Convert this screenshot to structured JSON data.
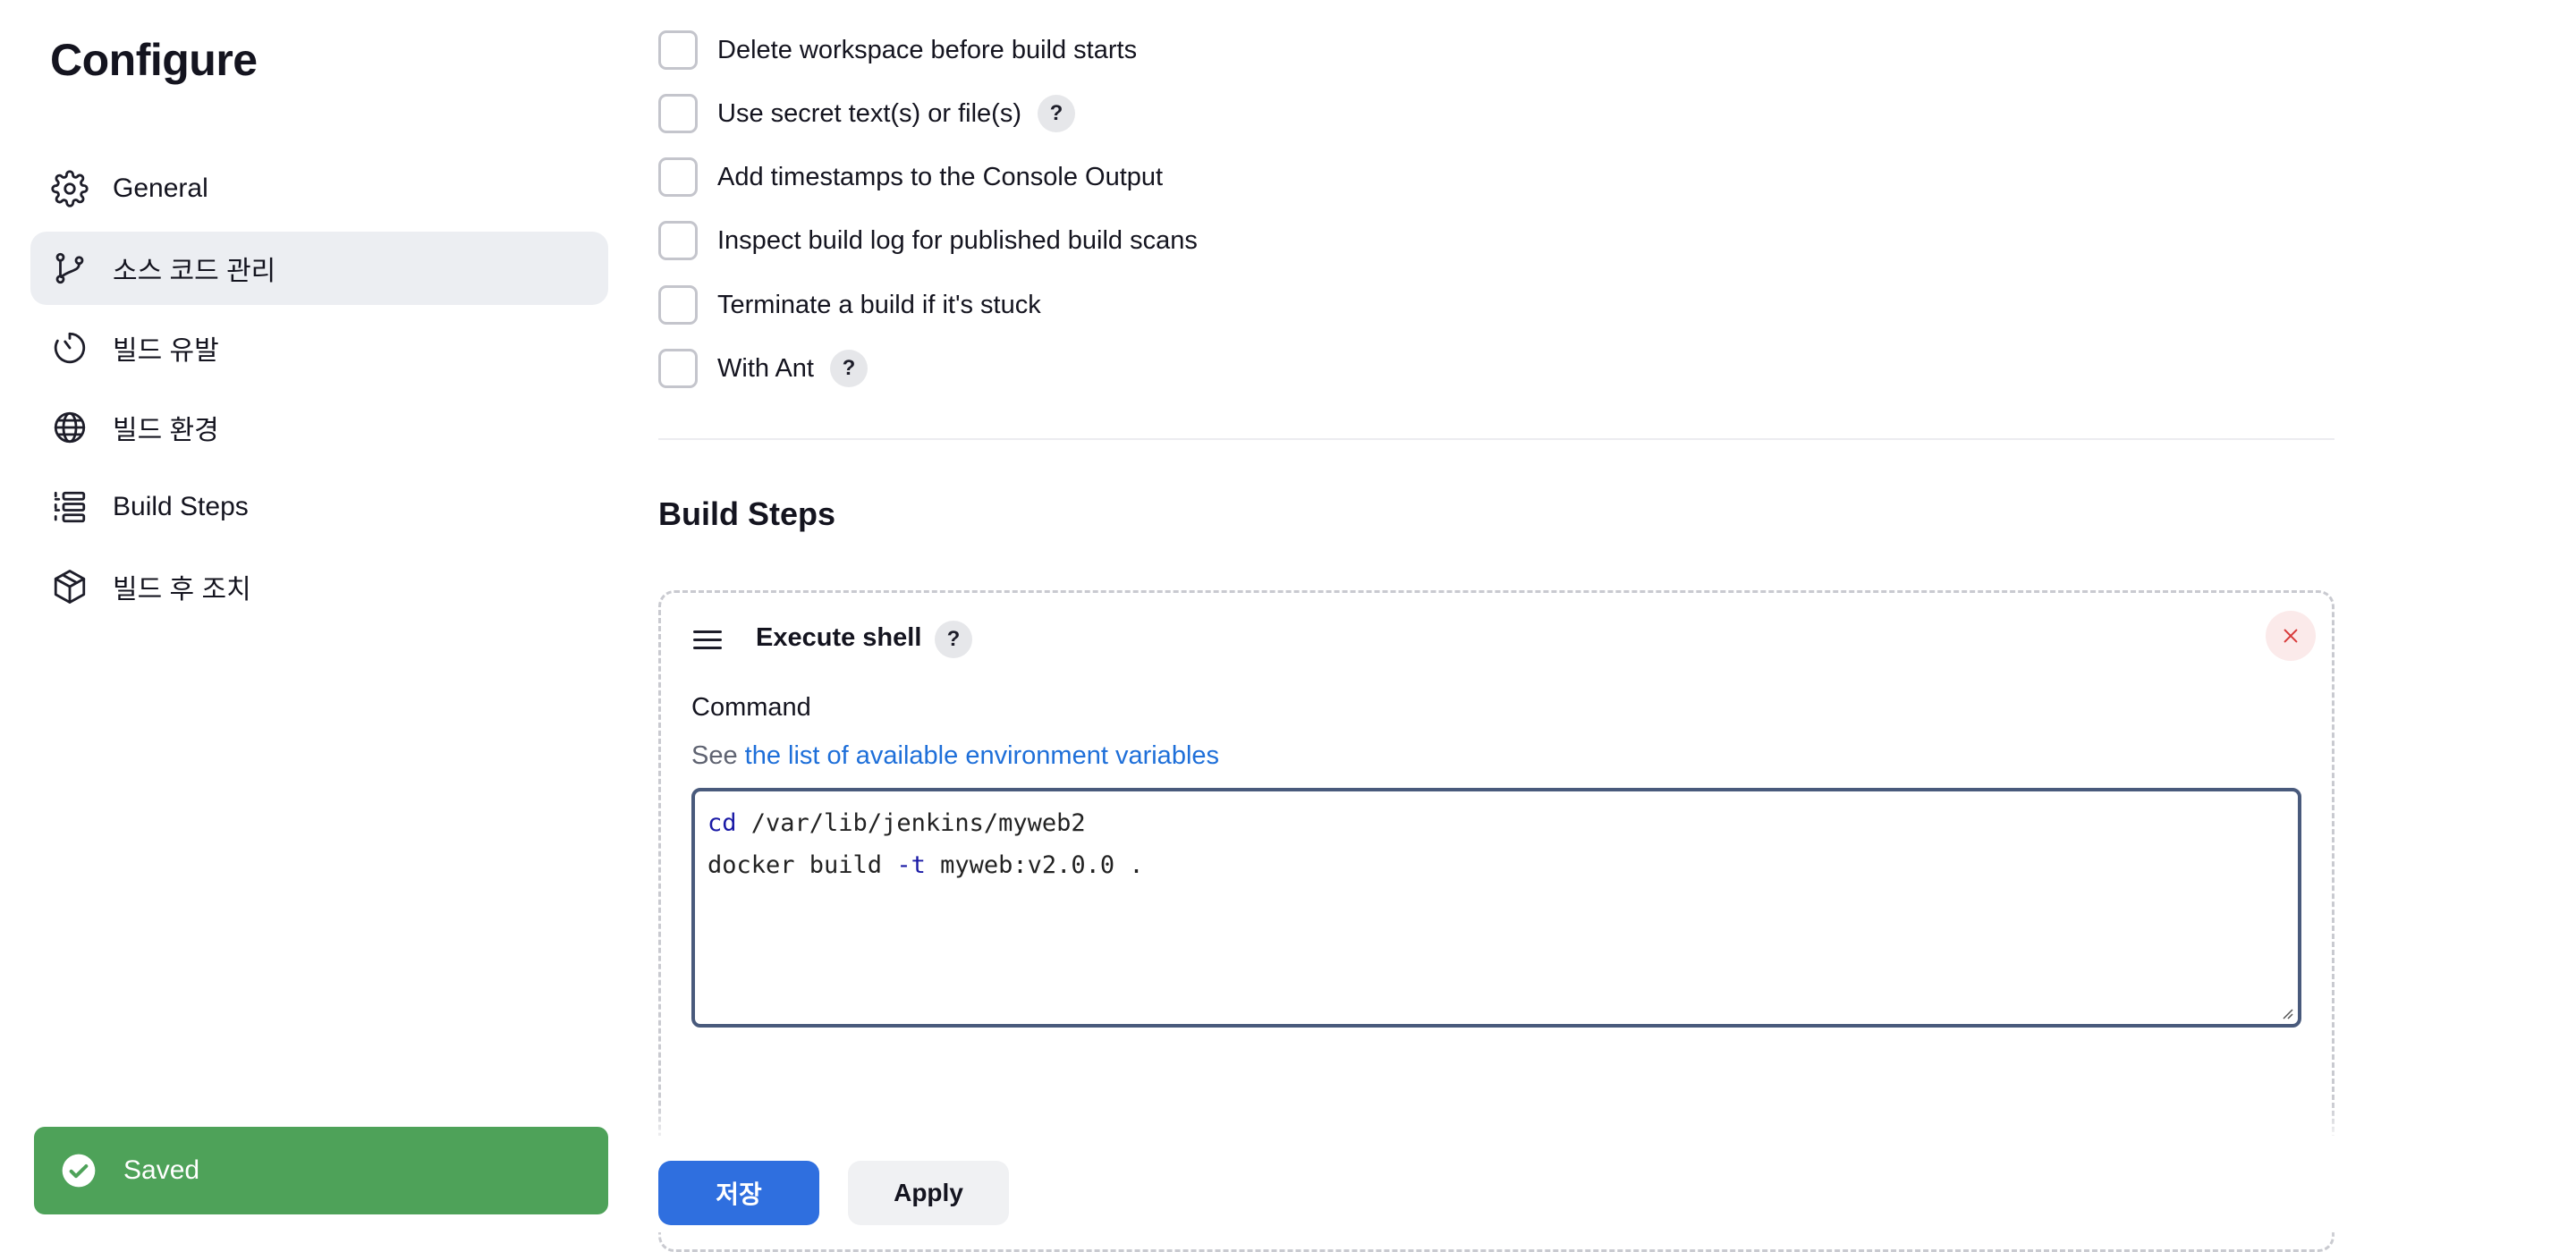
{
  "sidebar": {
    "title": "Configure",
    "items": [
      {
        "label": "General",
        "icon": "gear-icon"
      },
      {
        "label": "소스 코드 관리",
        "icon": "branch-icon",
        "active": true
      },
      {
        "label": "빌드 유발",
        "icon": "clock-icon"
      },
      {
        "label": "빌드 환경",
        "icon": "globe-icon"
      },
      {
        "label": "Build Steps",
        "icon": "list-steps-icon"
      },
      {
        "label": "빌드 후 조치",
        "icon": "package-icon"
      }
    ]
  },
  "build_environment": {
    "options": [
      {
        "label": "Delete workspace before build starts",
        "checked": false,
        "help": false
      },
      {
        "label": "Use secret text(s) or file(s)",
        "checked": false,
        "help": true
      },
      {
        "label": "Add timestamps to the Console Output",
        "checked": false,
        "help": false
      },
      {
        "label": "Inspect build log for published build scans",
        "checked": false,
        "help": false
      },
      {
        "label": "Terminate a build if it's stuck",
        "checked": false,
        "help": false
      },
      {
        "label": "With Ant",
        "checked": false,
        "help": true
      }
    ]
  },
  "build_steps": {
    "title": "Build Steps",
    "step": {
      "title": "Execute shell",
      "help": "?",
      "command_label": "Command",
      "see_prefix": "See",
      "see_link": "the list of available environment variables",
      "command_lines": [
        {
          "kw": "cd",
          "rest": " /var/lib/jenkins/myweb2"
        },
        {
          "pre": "docker build ",
          "kw": "-t",
          "rest": " myweb:v2.0.0 ."
        }
      ]
    }
  },
  "help_glyph": "?",
  "toast": {
    "label": "Saved",
    "color": "#4ea259"
  },
  "footer": {
    "save_label": "저장",
    "apply_label": "Apply"
  },
  "colors": {
    "accent": "#2f6fdf",
    "link": "#1e6fd9",
    "active_nav": "#eceef2"
  }
}
